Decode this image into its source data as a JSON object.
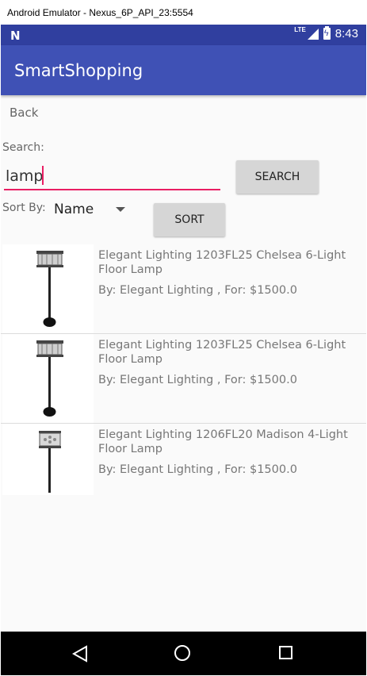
{
  "window": {
    "title": "Android Emulator - Nexus_6P_API_23:5554"
  },
  "status_bar": {
    "network": "LTE",
    "time": "8:43"
  },
  "app_bar": {
    "title": "SmartShopping"
  },
  "nav": {
    "back_label": "Back"
  },
  "search": {
    "label": "Search:",
    "value": "lamp",
    "button_label": "SEARCH"
  },
  "sort": {
    "label": "Sort By:",
    "selected": "Name",
    "button_label": "SORT"
  },
  "results": [
    {
      "title": "Elegant Lighting 1203FL25 Chelsea 6-Light Floor Lamp",
      "subtitle": "By: Elegant Lighting , For: $1500.0"
    },
    {
      "title": "Elegant Lighting 1203FL25 Chelsea 6-Light Floor Lamp",
      "subtitle": "By: Elegant Lighting , For: $1500.0"
    },
    {
      "title": "Elegant Lighting 1206FL20 Madison 4-Light Floor Lamp",
      "subtitle": "By: Elegant Lighting , For: $1500.0"
    }
  ],
  "colors": {
    "primary": "#3f51b5",
    "primary_dark": "#303f9f",
    "accent": "#e91e63"
  },
  "icons": {
    "status": "android-n-icon",
    "nav_back": "triangle-back-icon",
    "nav_home": "circle-home-icon",
    "nav_recent": "square-recents-icon"
  }
}
